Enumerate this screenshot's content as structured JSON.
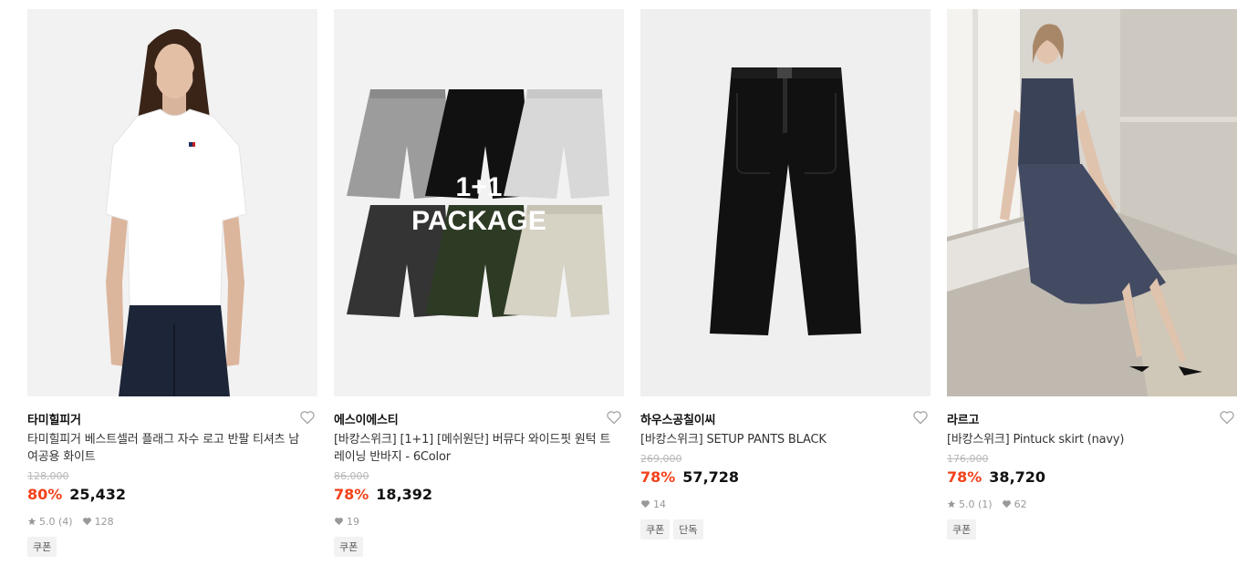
{
  "products": [
    {
      "brand": "타미힐피거",
      "name": "타미힐피거 베스트셀러 플래그 자수 로고 반팔 티셔츠 남여공용 화이트",
      "original_price": "128,000",
      "discount": "80%",
      "price": "25,432",
      "rating": "5.0 (4)",
      "likes": "128",
      "tags": [
        "쿠폰"
      ]
    },
    {
      "brand": "에스이에스티",
      "name": "[바캉스위크] [1+1] [메쉬원단] 버뮤다 와이드핏 원턱 트레이닝 반바지 - 6Color",
      "original_price": "86,000",
      "discount": "78%",
      "price": "18,392",
      "likes": "19",
      "tags": [
        "쿠폰"
      ],
      "image_text": [
        "1+1",
        "PACKAGE"
      ]
    },
    {
      "brand": "하우스공칠이씨",
      "name": "[바캉스위크] SETUP PANTS BLACK",
      "original_price": "269,000",
      "discount": "78%",
      "price": "57,728",
      "likes": "14",
      "tags": [
        "쿠폰",
        "단독"
      ]
    },
    {
      "brand": "라르고",
      "name": "[바캉스위크] Pintuck skirt (navy)",
      "original_price": "176,000",
      "discount": "78%",
      "price": "38,720",
      "rating": "5.0 (1)",
      "likes": "62",
      "tags": [
        "쿠폰"
      ]
    }
  ],
  "colors": {
    "discount": "#f2421b",
    "tag_bg": "#f2f2f2",
    "image_bg": "#efefef"
  },
  "icons": [
    "heart-outline-icon",
    "star-icon",
    "heart-icon"
  ]
}
